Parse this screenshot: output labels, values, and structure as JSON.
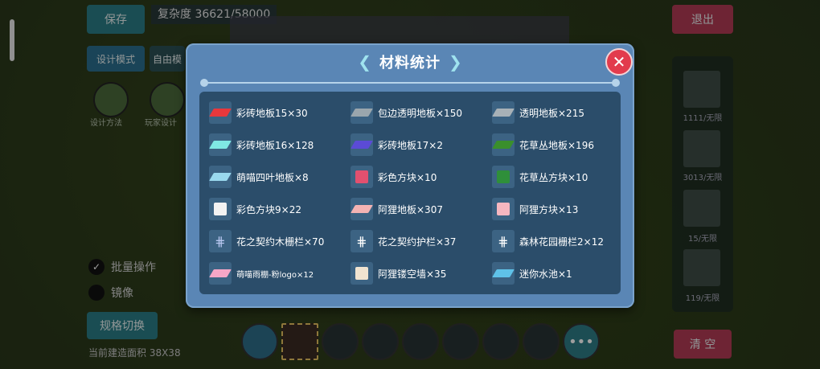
{
  "background": {
    "save_label": "保存",
    "complexity_text": "复杂度 36621/58000",
    "design_mode_label": "设计模式",
    "free_label": "自由模",
    "exit_label": "退出",
    "clear_label": "清 空",
    "spec_switch_label": "规格切换",
    "options": [
      "批量操作",
      "镜像"
    ],
    "area_text": "当前建造面积 38X38",
    "thumb_labels": [
      "设计方法",
      "玩家设计"
    ],
    "slot_labels": [
      "1111/无限",
      "3013/无限",
      "15/无限",
      "119/无限"
    ]
  },
  "dialog": {
    "title": "材料统计",
    "close_icon": "close-icon",
    "items": [
      {
        "label": "彩砖地板15×30",
        "icon": "red-floor-icon",
        "color": "#e8383c",
        "shape": "flat"
      },
      {
        "label": "包边透明地板×150",
        "icon": "glass-floor-icon",
        "color": "#9aa6ad",
        "shape": "flat"
      },
      {
        "label": "透明地板×215",
        "icon": "clear-floor-icon",
        "color": "#a8b1b7",
        "shape": "flat"
      },
      {
        "label": "彩砖地板16×128",
        "icon": "cyan-floor-icon",
        "color": "#7fe8e4",
        "shape": "flat"
      },
      {
        "label": "彩砖地板17×2",
        "icon": "blue-floor-icon",
        "color": "#5b4bd6",
        "shape": "flat"
      },
      {
        "label": "花草丛地板×196",
        "icon": "grass-floor-icon",
        "color": "#3a8f2c",
        "shape": "flat"
      },
      {
        "label": "萌喵四叶地板×8",
        "icon": "clover-floor-icon",
        "color": "#9ad9ee",
        "shape": "flat"
      },
      {
        "label": "彩色方块×10",
        "icon": "pink-cube-icon",
        "color": "#e2506f",
        "shape": "cube"
      },
      {
        "label": "花草丛方块×10",
        "icon": "grass-cube-icon",
        "color": "#2f8f3a",
        "shape": "cube"
      },
      {
        "label": "彩色方块9×22",
        "icon": "white-cube-icon",
        "color": "#f2f2f2",
        "shape": "cube"
      },
      {
        "label": "阿狸地板×307",
        "icon": "ali-floor-icon",
        "color": "#f4b3b3",
        "shape": "flat"
      },
      {
        "label": "阿狸方块×13",
        "icon": "ali-cube-icon",
        "color": "#f6b7c0",
        "shape": "cube"
      },
      {
        "label": "花之契约木栅栏×70",
        "icon": "wood-fence-icon",
        "color": "#b8c7f0",
        "shape": "fence"
      },
      {
        "label": "花之契约护栏×37",
        "icon": "guardrail-icon",
        "color": "#ffffff",
        "shape": "fence"
      },
      {
        "label": "森林花园栅栏2×12",
        "icon": "garden-fence-icon",
        "color": "#ffffff",
        "shape": "fence"
      },
      {
        "label": "萌喵雨棚-粉logo×12",
        "icon": "pink-awning-icon",
        "color": "#f6a6c6",
        "shape": "flat",
        "small": true
      },
      {
        "label": "阿狸镂空墙×35",
        "icon": "hollow-wall-icon",
        "color": "#f0e3d0",
        "shape": "cube"
      },
      {
        "label": "迷你水池×1",
        "icon": "mini-pool-icon",
        "color": "#5fc2e8",
        "shape": "flat"
      }
    ]
  }
}
